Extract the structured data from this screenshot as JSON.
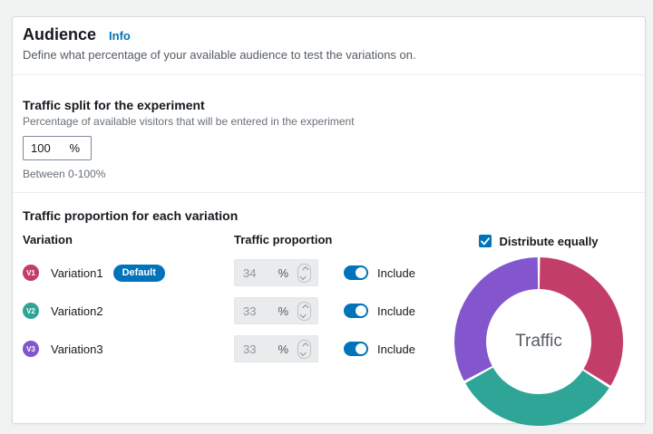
{
  "panel": {
    "title": "Audience",
    "info_link": "Info",
    "description": "Define what percentage of your available audience to test the variations on."
  },
  "traffic_split": {
    "title": "Traffic split for the experiment",
    "description": "Percentage of available visitors that will be entered in the experiment",
    "value": "100",
    "unit": "%",
    "constraint": "Between 0-100%"
  },
  "traffic_proportion": {
    "title": "Traffic proportion for each variation",
    "columns": {
      "variation": "Variation",
      "proportion": "Traffic proportion"
    },
    "rows": [
      {
        "badge": "V1",
        "name": "Variation1",
        "default_label": "Default",
        "value": "34",
        "unit": "%",
        "include": true,
        "toggle_label": "Include",
        "color": "#c33d69"
      },
      {
        "badge": "V2",
        "name": "Variation2",
        "value": "33",
        "unit": "%",
        "include": true,
        "toggle_label": "Include",
        "color": "#2ea597"
      },
      {
        "badge": "V3",
        "name": "Variation3",
        "value": "33",
        "unit": "%",
        "include": true,
        "toggle_label": "Include",
        "color": "#8456ce"
      }
    ],
    "distribute_equally_label": "Distribute equally",
    "distribute_equally_checked": true
  },
  "chart_data": {
    "type": "pie",
    "donut": true,
    "center_label": "Traffic",
    "categories": [
      "Variation1",
      "Variation2",
      "Variation3"
    ],
    "values": [
      34,
      33,
      33
    ],
    "colors": [
      "#c33d69",
      "#2ea597",
      "#8456ce"
    ],
    "start_angle": "top",
    "direction": "clockwise",
    "legend": "none"
  },
  "colors": {
    "accent_blue": "#0073bb",
    "variation1": "#c33d69",
    "variation2": "#2ea597",
    "variation3": "#8456ce",
    "disabled_field_bg": "#e9ebed"
  }
}
